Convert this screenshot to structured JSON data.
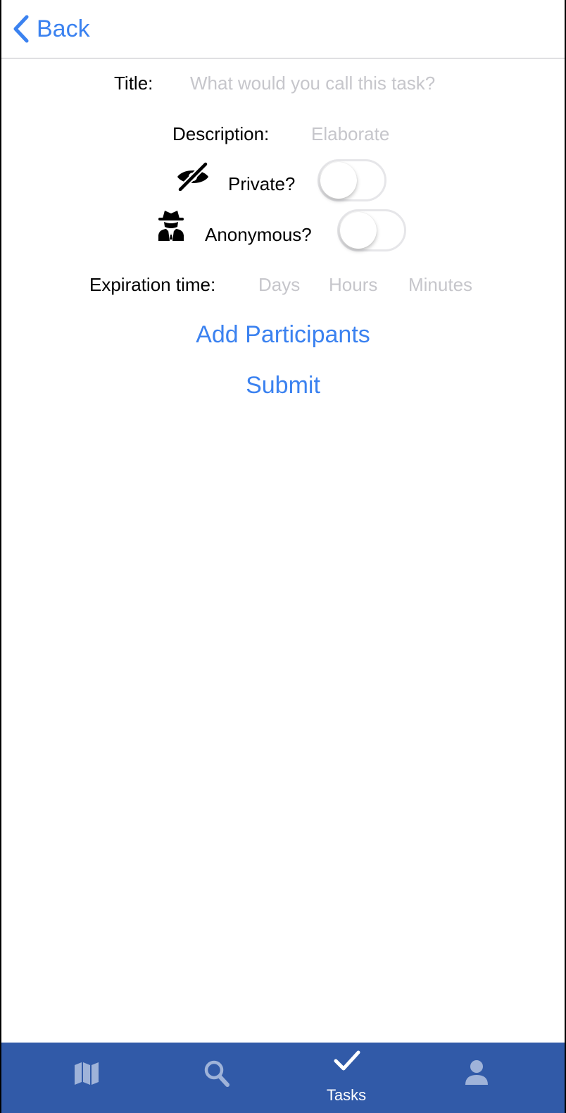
{
  "header": {
    "back_label": "Back"
  },
  "form": {
    "title_label": "Title:",
    "title_placeholder": "What would you call this task?",
    "description_label": "Description:",
    "description_placeholder": "Elaborate",
    "private_label": "Private?",
    "private_on": false,
    "anonymous_label": "Anonymous?",
    "anonymous_on": false,
    "expiration_label": "Expiration time:",
    "days_placeholder": "Days",
    "hours_placeholder": "Hours",
    "minutes_placeholder": "Minutes",
    "add_participants_label": "Add Participants",
    "submit_label": "Submit"
  },
  "tabbar": {
    "tabs": [
      {
        "icon": "map-icon",
        "label": ""
      },
      {
        "icon": "search-icon",
        "label": ""
      },
      {
        "icon": "checkmark-icon",
        "label": "Tasks",
        "active": true
      },
      {
        "icon": "profile-icon",
        "label": ""
      }
    ]
  },
  "colors": {
    "accent": "#3b82f0",
    "tabbar_bg": "#315aa8",
    "placeholder": "#c6c6cb"
  }
}
